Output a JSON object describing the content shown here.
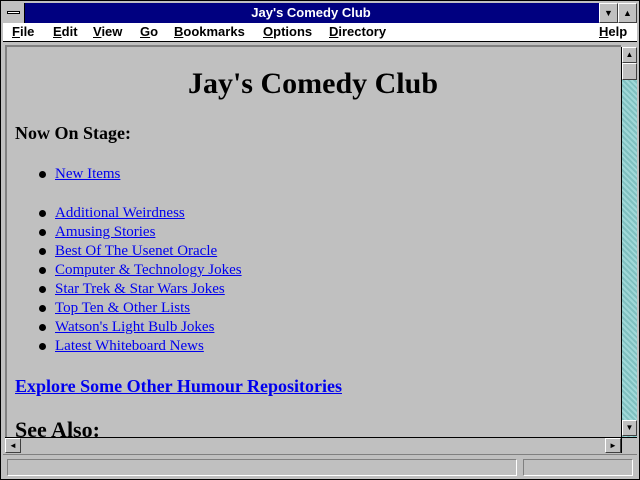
{
  "window": {
    "title": "Jay's Comedy Club",
    "minimize_glyph": "▼",
    "maximize_glyph": "▲"
  },
  "menu": {
    "items": [
      {
        "key": "F",
        "rest": "ile"
      },
      {
        "key": "E",
        "rest": "dit"
      },
      {
        "key": "V",
        "rest": "iew"
      },
      {
        "key": "G",
        "rest": "o"
      },
      {
        "key": "B",
        "rest": "ookmarks"
      },
      {
        "key": "O",
        "rest": "ptions"
      },
      {
        "key": "D",
        "rest": "irectory"
      },
      {
        "key": "H",
        "rest": "elp"
      }
    ]
  },
  "page": {
    "title": "Jay's Comedy Club",
    "section_heading": "Now On Stage:",
    "links": [
      "New Items",
      "Additional Weirdness",
      "Amusing Stories",
      "Best Of The Usenet Oracle",
      "Computer & Technology Jokes",
      "Star Trek & Star Wars Jokes",
      "Top Ten & Other Lists",
      "Watson's Light Bulb Jokes",
      "Latest Whiteboard News"
    ],
    "explore_link": "Explore Some Other Humour Repositories",
    "see_also": "See Also:"
  },
  "scrollbars": {
    "up_glyph": "▲",
    "down_glyph": "▼",
    "left_glyph": "◄",
    "right_glyph": "►"
  },
  "status": {
    "text": ""
  },
  "colors": {
    "titlebar": "#000080",
    "link": "#0000ee",
    "window_bg": "#c0c0c0",
    "scroll_track": "#80c0c0"
  }
}
